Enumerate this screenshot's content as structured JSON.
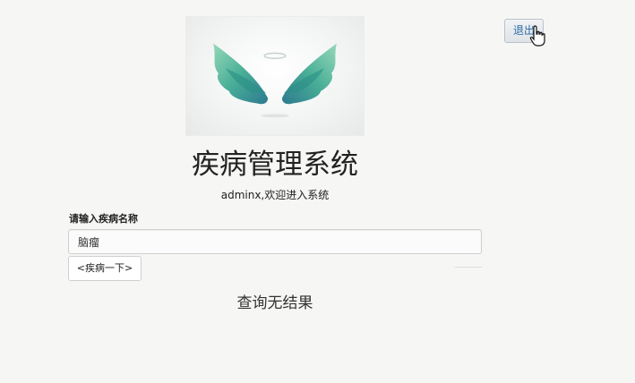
{
  "header": {
    "logout_label": "退出"
  },
  "logo": {
    "icon": "angel-wings-logo",
    "colors": [
      "#2f9e8a",
      "#5cc0a6",
      "#1e7c8a"
    ]
  },
  "main": {
    "title": "疾病管理系统",
    "welcome": "adminx,欢迎进入系统",
    "search": {
      "label": "请输入疾病名称",
      "value": "脑瘤",
      "button_label": "<疾病一下>"
    },
    "result_text": "查询无结果"
  }
}
